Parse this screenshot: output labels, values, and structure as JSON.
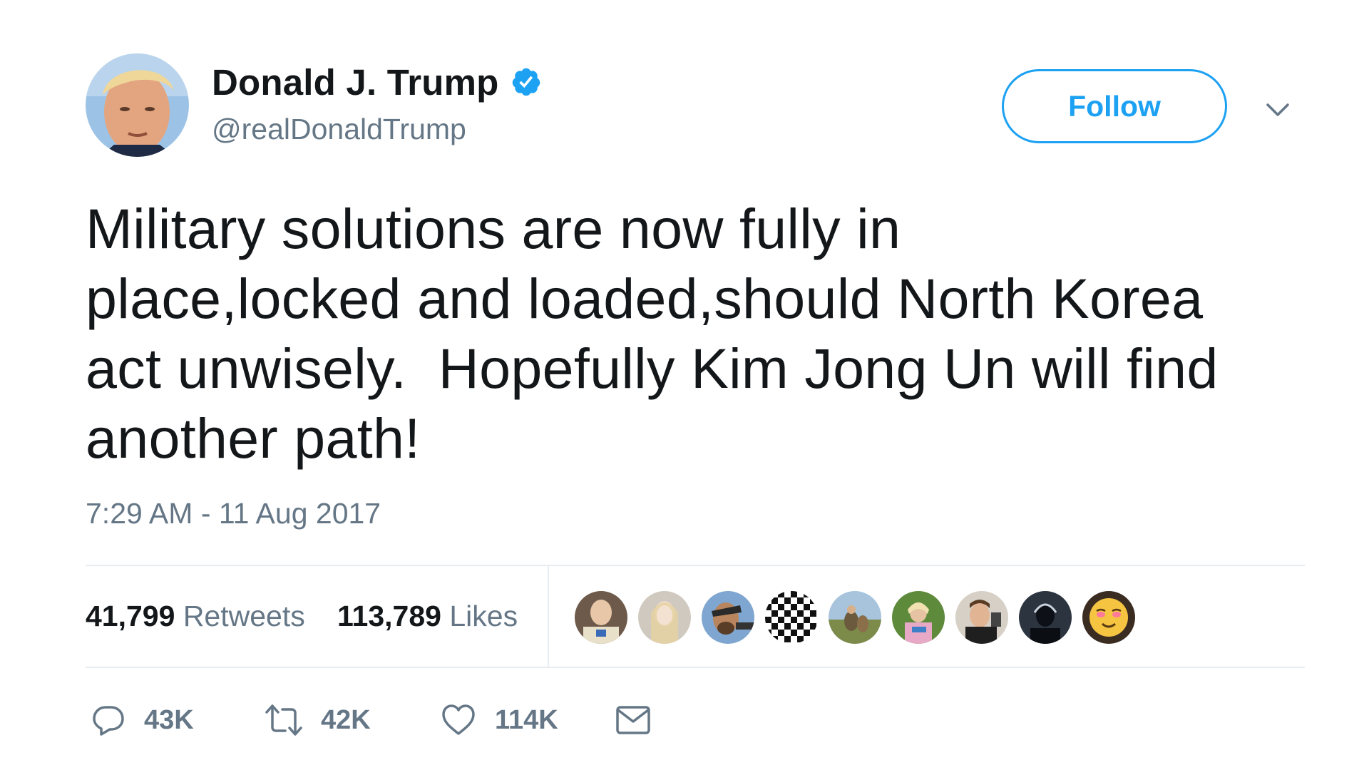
{
  "user": {
    "name": "Donald J. Trump",
    "handle": "@realDonaldTrump",
    "verified": true
  },
  "follow_label": "Follow",
  "tweet": {
    "text": "Military solutions are now fully in\nplace,locked and loaded,should North Korea\nact unwisely.  Hopefully Kim Jong Un will find\nanother path!",
    "timestamp": "7:29 AM - 11 Aug 2017"
  },
  "stats": {
    "retweets_count": "41,799",
    "retweets_label": "Retweets",
    "likes_count": "113,789",
    "likes_label": "Likes"
  },
  "actions": {
    "reply_count": "43K",
    "retweet_count": "42K",
    "like_count": "114K"
  },
  "colors": {
    "accent": "#1da1f2",
    "text_primary": "#14171a",
    "text_secondary": "#657786",
    "divider": "#e6ecf0"
  },
  "icons": {
    "verified": "verified-badge-icon",
    "menu": "chevron-down-icon",
    "reply": "reply-icon",
    "retweet": "retweet-icon",
    "like": "heart-icon",
    "message": "envelope-icon"
  }
}
